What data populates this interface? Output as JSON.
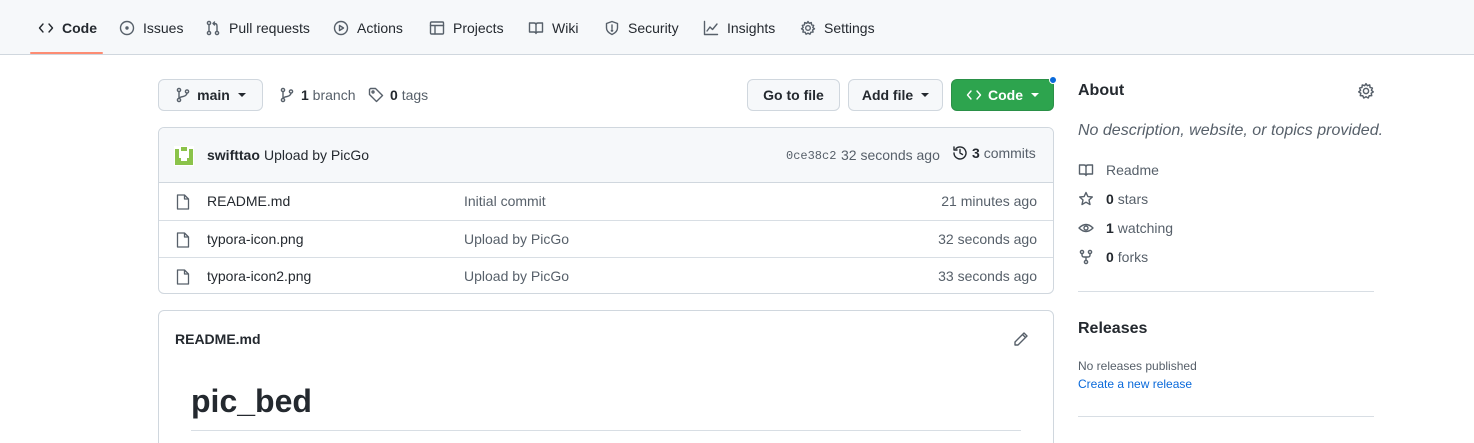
{
  "nav": {
    "tabs": [
      {
        "label": "Code",
        "icon": "code-icon"
      },
      {
        "label": "Issues",
        "icon": "issue-icon"
      },
      {
        "label": "Pull requests",
        "icon": "pull-request-icon"
      },
      {
        "label": "Actions",
        "icon": "play-icon"
      },
      {
        "label": "Projects",
        "icon": "table-icon"
      },
      {
        "label": "Wiki",
        "icon": "book-icon"
      },
      {
        "label": "Security",
        "icon": "shield-icon"
      },
      {
        "label": "Insights",
        "icon": "graph-icon"
      },
      {
        "label": "Settings",
        "icon": "gear-icon"
      }
    ],
    "active_tab": "Code"
  },
  "toolbar": {
    "branch": "main",
    "branch_count": "1",
    "branch_label": "branch",
    "tag_count": "0",
    "tag_label": "tags",
    "go_to_file": "Go to file",
    "add_file": "Add file",
    "code": "Code"
  },
  "latest_commit": {
    "author": "swifttao",
    "message": "Upload by PicGo",
    "sha": "0ce38c2",
    "time": "32 seconds ago",
    "commit_count": "3",
    "commit_label": "commits"
  },
  "files": [
    {
      "name": "README.md",
      "message": "Initial commit",
      "time": "21 minutes ago"
    },
    {
      "name": "typora-icon.png",
      "message": "Upload by PicGo",
      "time": "32 seconds ago"
    },
    {
      "name": "typora-icon2.png",
      "message": "Upload by PicGo",
      "time": "33 seconds ago"
    }
  ],
  "readme": {
    "filename": "README.md",
    "heading": "pic_bed"
  },
  "about": {
    "title": "About",
    "description": "No description, website, or topics provided.",
    "readme_label": "Readme",
    "stars_count": "0",
    "stars_label": "stars",
    "watching_count": "1",
    "watching_label": "watching",
    "forks_count": "0",
    "forks_label": "forks"
  },
  "releases": {
    "title": "Releases",
    "empty_text": "No releases published",
    "create_link": "Create a new release"
  },
  "colors": {
    "accent_green": "#2da44e",
    "link_blue": "#0969da",
    "active_tab_underline": "#fd8c73",
    "avatar_green": "#8bc34a"
  }
}
